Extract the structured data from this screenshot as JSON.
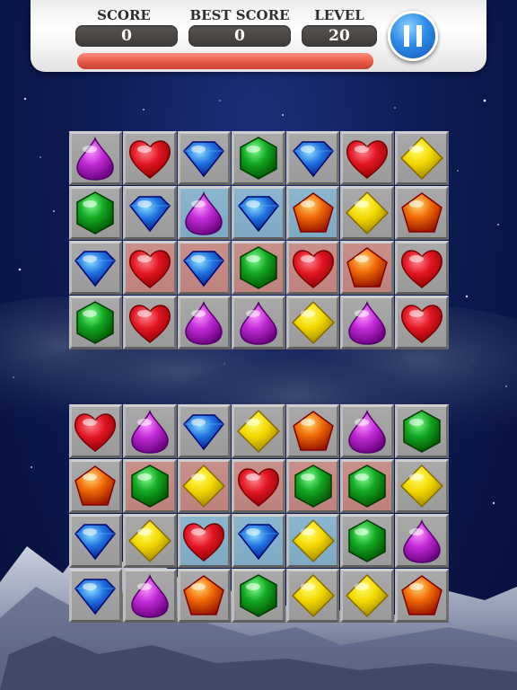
{
  "hud": {
    "score_label": "SCORE",
    "score_value": "0",
    "best_score_label": "BEST SCORE",
    "best_score_value": "0",
    "level_label": "LEVEL",
    "level_value": "20",
    "progress_fraction": 0.0
  },
  "colors": {
    "purple": "#c12bd6",
    "red": "#e21521",
    "blue": "#1f72df",
    "green": "#13a822",
    "orange": "#f06a06",
    "yellow": "#f3d800",
    "cell_blue_tint": "#8ab6cf",
    "cell_red_tint": "#c98f8a"
  },
  "boards": [
    {
      "name": "top",
      "rows": [
        [
          {
            "g": "purple-drop",
            "t": "n"
          },
          {
            "g": "red-heart",
            "t": "n"
          },
          {
            "g": "blue-diamond",
            "t": "n"
          },
          {
            "g": "green-hexagon",
            "t": "n"
          },
          {
            "g": "blue-diamond",
            "t": "n"
          },
          {
            "g": "red-heart",
            "t": "n"
          },
          {
            "g": "yellow-square",
            "t": "n"
          }
        ],
        [
          {
            "g": "green-hexagon",
            "t": "n"
          },
          {
            "g": "blue-diamond",
            "t": "n"
          },
          {
            "g": "purple-drop",
            "t": "b"
          },
          {
            "g": "blue-diamond",
            "t": "b"
          },
          {
            "g": "orange-pentagon",
            "t": "b"
          },
          {
            "g": "yellow-square",
            "t": "n"
          },
          {
            "g": "orange-pentagon",
            "t": "n"
          }
        ],
        [
          {
            "g": "blue-diamond",
            "t": "n"
          },
          {
            "g": "red-heart",
            "t": "r"
          },
          {
            "g": "blue-diamond",
            "t": "r"
          },
          {
            "g": "green-hexagon",
            "t": "r"
          },
          {
            "g": "red-heart",
            "t": "r"
          },
          {
            "g": "orange-pentagon",
            "t": "r"
          },
          {
            "g": "red-heart",
            "t": "n"
          }
        ],
        [
          {
            "g": "green-hexagon",
            "t": "n"
          },
          {
            "g": "red-heart",
            "t": "n"
          },
          {
            "g": "purple-drop",
            "t": "n"
          },
          {
            "g": "purple-drop",
            "t": "n"
          },
          {
            "g": "yellow-square",
            "t": "n"
          },
          {
            "g": "purple-drop",
            "t": "n"
          },
          {
            "g": "red-heart",
            "t": "n"
          }
        ]
      ]
    },
    {
      "name": "bottom",
      "rows": [
        [
          {
            "g": "red-heart",
            "t": "n"
          },
          {
            "g": "purple-drop",
            "t": "n"
          },
          {
            "g": "blue-diamond",
            "t": "n"
          },
          {
            "g": "yellow-square",
            "t": "n"
          },
          {
            "g": "orange-pentagon",
            "t": "n"
          },
          {
            "g": "purple-drop",
            "t": "n"
          },
          {
            "g": "green-hexagon",
            "t": "n"
          }
        ],
        [
          {
            "g": "orange-pentagon",
            "t": "n"
          },
          {
            "g": "green-hexagon",
            "t": "r"
          },
          {
            "g": "yellow-square",
            "t": "r"
          },
          {
            "g": "red-heart",
            "t": "r"
          },
          {
            "g": "green-hexagon",
            "t": "r"
          },
          {
            "g": "green-hexagon",
            "t": "r"
          },
          {
            "g": "yellow-square",
            "t": "n"
          }
        ],
        [
          {
            "g": "blue-diamond",
            "t": "n"
          },
          {
            "g": "yellow-square",
            "t": "n"
          },
          {
            "g": "red-heart",
            "t": "b"
          },
          {
            "g": "blue-diamond",
            "t": "b"
          },
          {
            "g": "yellow-square",
            "t": "b"
          },
          {
            "g": "green-hexagon",
            "t": "n"
          },
          {
            "g": "purple-drop",
            "t": "n"
          }
        ],
        [
          {
            "g": "blue-diamond",
            "t": "n"
          },
          {
            "g": "purple-drop",
            "t": "n"
          },
          {
            "g": "orange-pentagon",
            "t": "n"
          },
          {
            "g": "green-hexagon",
            "t": "n"
          },
          {
            "g": "yellow-square",
            "t": "n"
          },
          {
            "g": "yellow-square",
            "t": "n"
          },
          {
            "g": "orange-pentagon",
            "t": "n"
          }
        ]
      ]
    }
  ]
}
